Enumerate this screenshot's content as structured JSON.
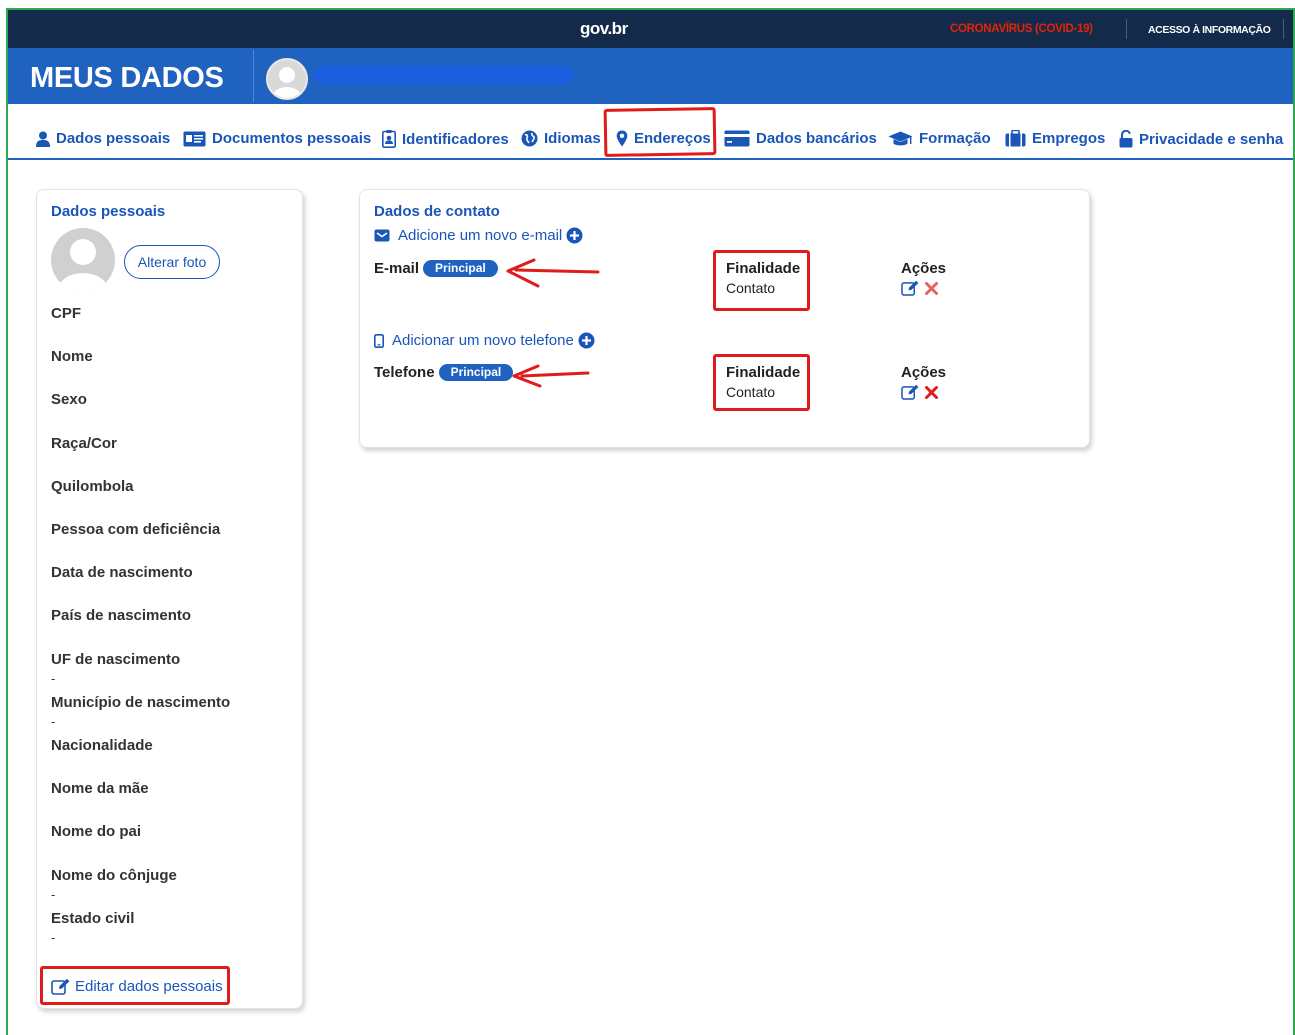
{
  "topbar": {
    "logo": "gov.br",
    "covid_link": "CORONAVÍRUS (COVID-19)",
    "acesso_link": "ACESSO À INFORMAÇÃO"
  },
  "header": {
    "title": "MEUS DADOS"
  },
  "nav": {
    "items": [
      {
        "label": "Dados pessoais",
        "icon": "user-icon"
      },
      {
        "label": "Documentos pessoais",
        "icon": "id-card-icon"
      },
      {
        "label": "Identificadores",
        "icon": "badge-icon"
      },
      {
        "label": "Idiomas",
        "icon": "globe-icon"
      },
      {
        "label": "Endereços",
        "icon": "map-marker-icon"
      },
      {
        "label": "Dados bancários",
        "icon": "credit-card-icon"
      },
      {
        "label": "Formação",
        "icon": "graduation-cap-icon"
      },
      {
        "label": "Empregos",
        "icon": "briefcase-icon"
      },
      {
        "label": "Privacidade e senha",
        "icon": "lock-icon"
      }
    ]
  },
  "personal": {
    "title": "Dados pessoais",
    "change_photo": "Alterar foto",
    "fields": [
      {
        "label": "CPF",
        "value": ""
      },
      {
        "label": "Nome",
        "value": ""
      },
      {
        "label": "Sexo",
        "value": ""
      },
      {
        "label": "Raça/Cor",
        "value": ""
      },
      {
        "label": "Quilombola",
        "value": ""
      },
      {
        "label": "Pessoa com deficiência",
        "value": ""
      },
      {
        "label": "Data de nascimento",
        "value": ""
      },
      {
        "label": "País de nascimento",
        "value": ""
      },
      {
        "label": "UF de nascimento",
        "value": "-"
      },
      {
        "label": "Município de nascimento",
        "value": "-"
      },
      {
        "label": "Nacionalidade",
        "value": ""
      },
      {
        "label": "Nome da mãe",
        "value": ""
      },
      {
        "label": "Nome do pai",
        "value": ""
      },
      {
        "label": "Nome do cônjuge",
        "value": "-"
      },
      {
        "label": "Estado civil",
        "value": "-"
      }
    ],
    "edit_link": "Editar dados pessoais"
  },
  "contact": {
    "title": "Dados de contato",
    "add_email": "Adicione um novo e-mail",
    "add_phone": "Adicionar um novo telefone",
    "email": {
      "label": "E-mail",
      "badge": "Principal",
      "purpose_title": "Finalidade",
      "purpose_value": "Contato",
      "actions_title": "Ações"
    },
    "phone": {
      "label": "Telefone",
      "badge": "Principal",
      "purpose_title": "Finalidade",
      "purpose_value": "Contato",
      "actions_title": "Ações"
    }
  },
  "colors": {
    "topbar": "#132a4a",
    "header": "#1f62bf",
    "link": "#1a55b8",
    "covid": "#e52207",
    "annotation": "#e01b1b",
    "frame": "#2fa84f"
  }
}
